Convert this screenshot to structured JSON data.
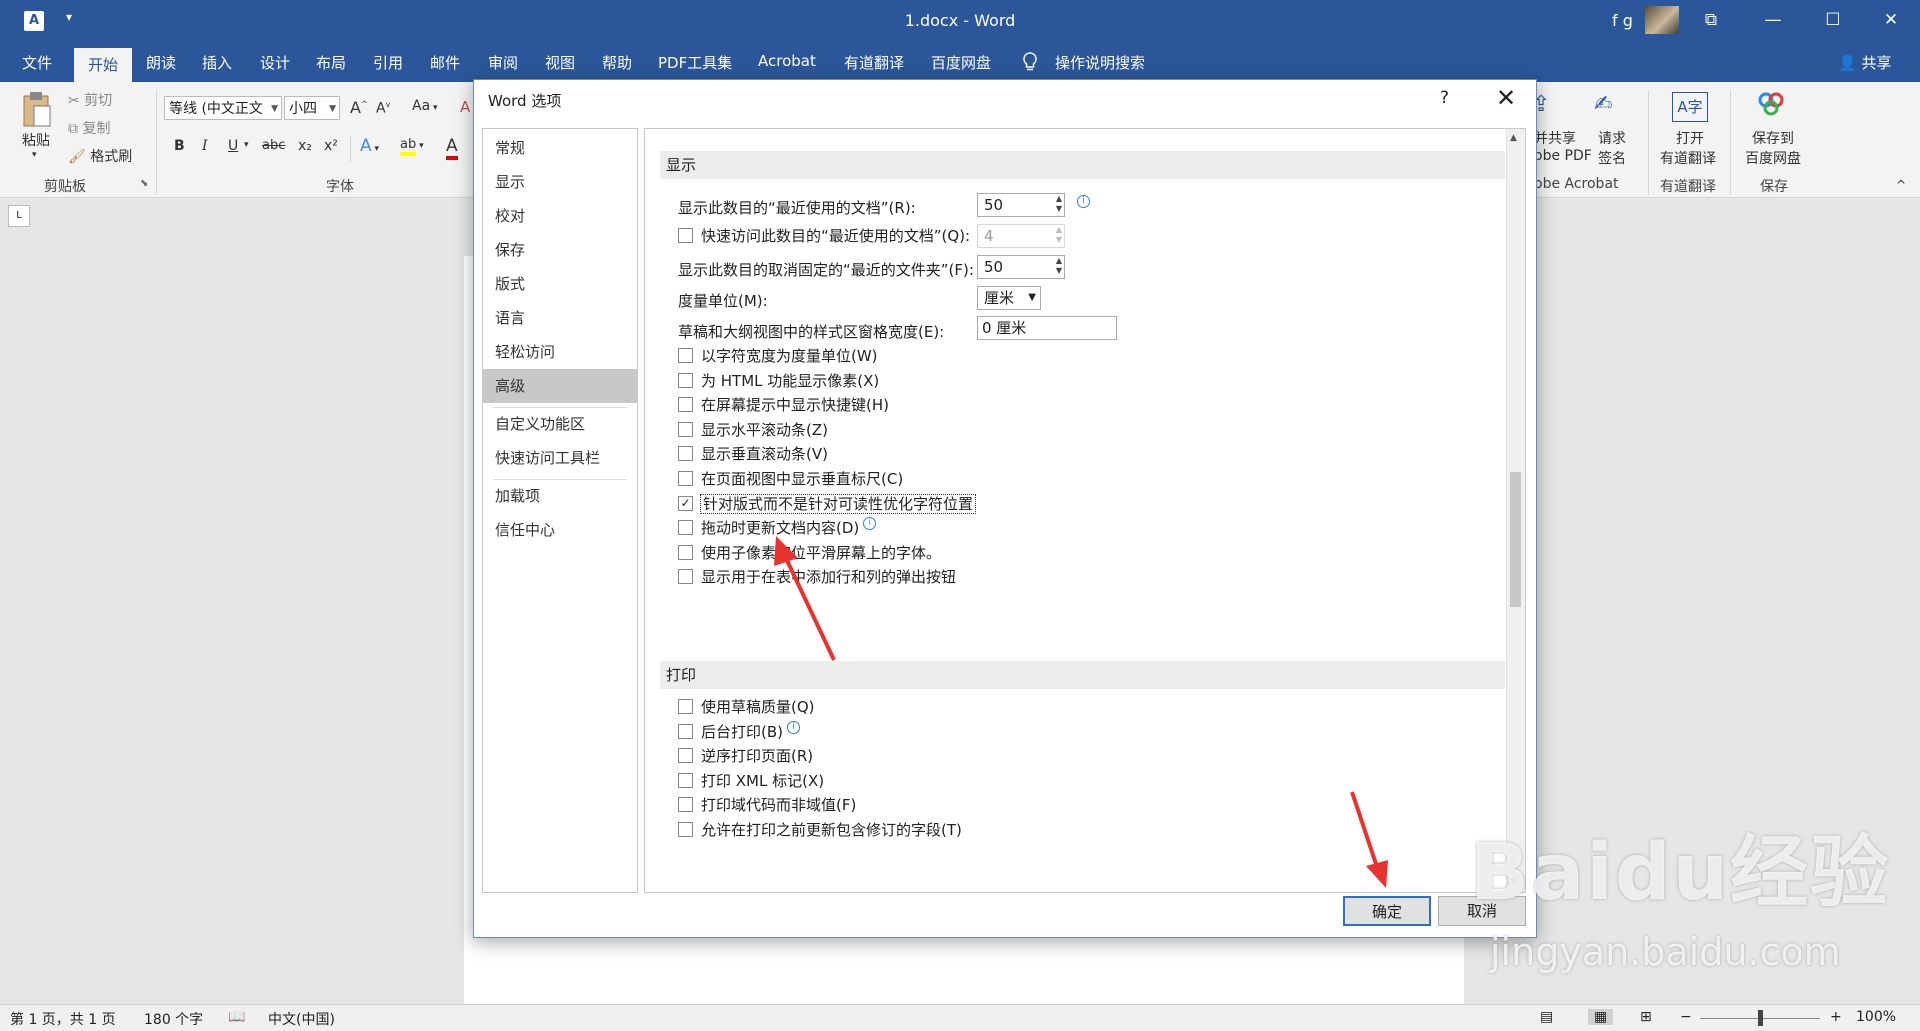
{
  "titlebar": {
    "app_icon": "A",
    "qat_dropdown": "▾",
    "title": "1.docx  -  Word",
    "user": "f g",
    "btn_ribbon_display": "⧉",
    "btn_minimize": "—",
    "btn_maximize": "☐",
    "btn_close": "✕"
  },
  "menu": {
    "items": [
      "文件",
      "开始",
      "朗读",
      "插入",
      "设计",
      "布局",
      "引用",
      "邮件",
      "审阅",
      "视图",
      "帮助",
      "PDF工具集",
      "Acrobat",
      "有道翻译",
      "百度网盘"
    ],
    "search_icon": "lightbulb-icon",
    "search": "操作说明搜索",
    "share": "共享"
  },
  "ribbon": {
    "paste": "粘贴",
    "cut": "剪切",
    "copy": "复制",
    "format_painter": "格式刷",
    "clipboard_group": "剪贴板",
    "font_name": "等线 (中文正文",
    "font_size": "小四",
    "font_group": "字体",
    "grow": "A",
    "shrink": "A",
    "change_case": "Aa",
    "bold": "B",
    "italic": "I",
    "underline": "U",
    "strike": "abc",
    "sub": "x₂",
    "sup": "x²",
    "text_effects": "A",
    "highlight": "ab",
    "font_color": "A",
    "share_pdf_1": "并共享",
    "share_pdf_2": "obe PDF",
    "request_sign_1": "请求",
    "request_sign_2": "签名",
    "acrobat_group": "obe Acrobat",
    "open_youdao_1": "打开",
    "open_youdao_2": "有道翻译",
    "youdao_group": "有道翻译",
    "baidu_save_1": "保存到",
    "baidu_save_2": "百度网盘",
    "save_group": "保存",
    "collapse": "^"
  },
  "status": {
    "page": "第 1 页，共 1 页",
    "words": "180 个字",
    "lang": "中文(中国)",
    "zoom_minus": "−",
    "zoom_plus": "+",
    "zoom": "100%",
    "zoom_level": 100
  },
  "dialog": {
    "title": "Word 选项",
    "help": "?",
    "close": "✕",
    "nav": [
      "常规",
      "显示",
      "校对",
      "保存",
      "版式",
      "语言",
      "轻松访问",
      "高级",
      "自定义功能区",
      "快速访问工具栏",
      "加载项",
      "信任中心"
    ],
    "selected_nav": "高级",
    "section_display": "显示",
    "recent_docs_label": "显示此数目的“最近使用的文档”(R):",
    "recent_docs_value": "50",
    "quick_access_label": "快速访问此数目的“最近使用的文档”(Q):",
    "quick_access_value": "4",
    "unpinned_folders_label": "显示此数目的取消固定的“最近的文件夹”(F):",
    "unpinned_folders_value": "50",
    "units_label": "度量单位(M):",
    "units_value": "厘米",
    "style_width_label": "草稿和大纲视图中的样式区窗格宽度(E):",
    "style_width_value": "0 厘米",
    "display_checks": [
      {
        "label": "以字符宽度为度量单位(W)",
        "checked": false,
        "info": false
      },
      {
        "label": "为 HTML 功能显示像素(X)",
        "checked": false,
        "info": false
      },
      {
        "label": "在屏幕提示中显示快捷键(H)",
        "checked": false,
        "info": false
      },
      {
        "label": "显示水平滚动条(Z)",
        "checked": false,
        "info": false
      },
      {
        "label": "显示垂直滚动条(V)",
        "checked": false,
        "info": false
      },
      {
        "label": "在页面视图中显示垂直标尺(C)",
        "checked": false,
        "info": false
      },
      {
        "label": "针对版式而不是针对可读性优化字符位置",
        "checked": true,
        "info": false
      },
      {
        "label": "拖动时更新文档内容(D)",
        "checked": false,
        "info": true
      },
      {
        "label": "使用子像素定位平滑屏幕上的字体。",
        "checked": false,
        "info": false
      },
      {
        "label": "显示用于在表中添加行和列的弹出按钮",
        "checked": false,
        "info": false
      }
    ],
    "section_print": "打印",
    "print_checks": [
      {
        "label": "使用草稿质量(Q)",
        "checked": false,
        "info": false
      },
      {
        "label": "后台打印(B)",
        "checked": false,
        "info": true
      },
      {
        "label": "逆序打印页面(R)",
        "checked": false,
        "info": false
      },
      {
        "label": "打印 XML 标记(X)",
        "checked": false,
        "info": false
      },
      {
        "label": "打印域代码而非域值(F)",
        "checked": false,
        "info": false
      },
      {
        "label": "允许在打印之前更新包含修订的字段(T)",
        "checked": false,
        "info": false
      }
    ],
    "ok": "确定",
    "cancel": "取消"
  },
  "watermark": {
    "brand": "Baidu经验",
    "sub": "jingyan.baidu.com"
  },
  "colors": {
    "accent": "#2b579a",
    "arrow": "#e8322e"
  }
}
